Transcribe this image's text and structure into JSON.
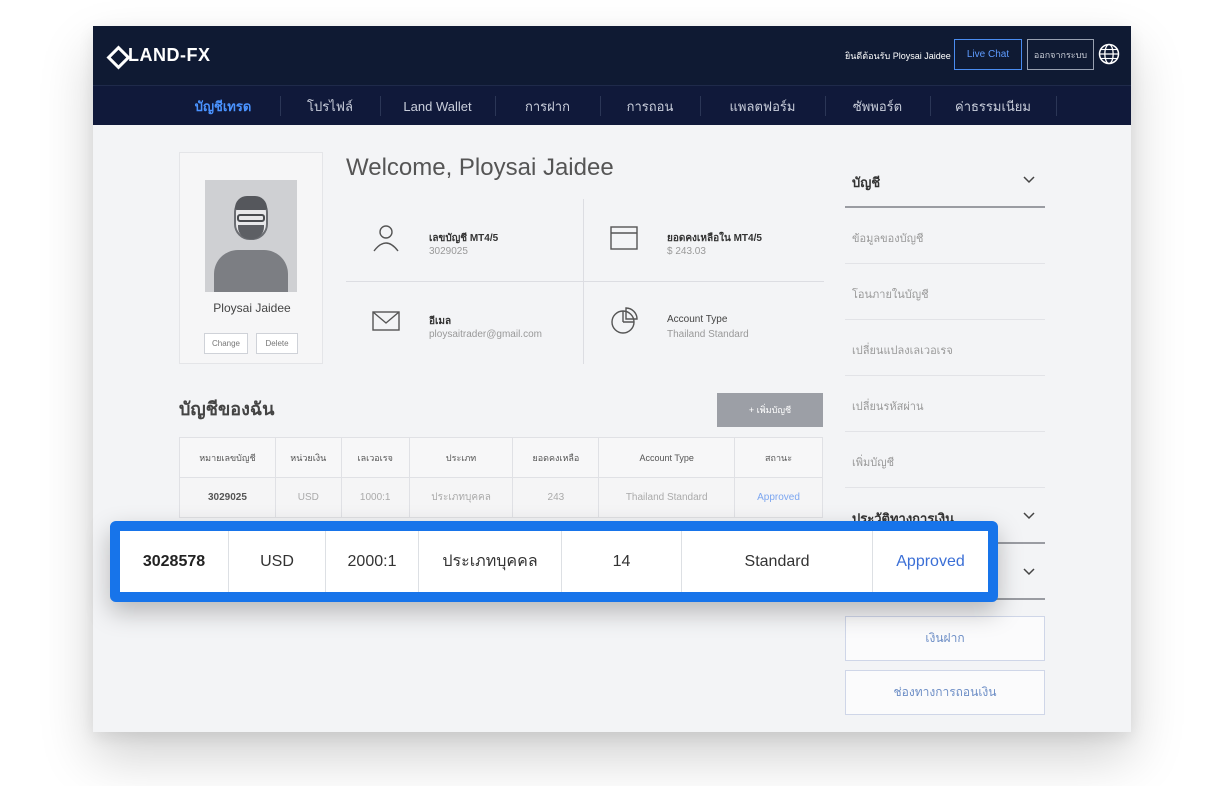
{
  "header": {
    "logo_text": "LAND-FX",
    "welcome": "ยินดีต้อนรับ Ploysai Jaidee",
    "live_chat": "Live Chat",
    "logout": "ออกจากระบบ"
  },
  "nav": {
    "items": [
      {
        "label": "บัญชีเทรด",
        "active": true
      },
      {
        "label": "โปรไฟล์"
      },
      {
        "label": "Land Wallet"
      },
      {
        "label": "การฝาก"
      },
      {
        "label": "การถอน"
      },
      {
        "label": "แพลตฟอร์ม"
      },
      {
        "label": "ซัพพอร์ต"
      },
      {
        "label": "ค่าธรรมเนียม"
      }
    ]
  },
  "profile": {
    "name": "Ploysai Jaidee",
    "change_label": "Change",
    "delete_label": "Delete"
  },
  "welcome_heading": "Welcome, Ploysai Jaidee",
  "info": {
    "account_label": "เลขบัญชี MT4/5",
    "account_value": "3029025",
    "balance_label": "ยอดคงเหลือใน MT4/5",
    "balance_value": "$ 243.03",
    "email_label": "อีเมล",
    "email_value": "ploysaitrader@gmail.com",
    "type_label": "Account Type",
    "type_value": "Thailand Standard"
  },
  "accounts": {
    "title": "บัญชีของฉัน",
    "add_button": "+ เพิ่มบัญชี",
    "headers": [
      "หมายเลขบัญชี",
      "หน่วยเงิน",
      "เลเวอเรจ",
      "ประเภท",
      "ยอดคงเหลือ",
      "Account Type",
      "สถานะ"
    ],
    "rows": [
      [
        "3029025",
        "USD",
        "1000:1",
        "ประเภทบุคคล",
        "243",
        "Thailand Standard",
        "Approved"
      ]
    ]
  },
  "sidebar": {
    "account_header": "บัญชี",
    "items": [
      "ข้อมูลของบัญชี",
      "โอนภายในบัญชี",
      "เปลี่ยนแปลงเลเวอเรจ",
      "เปลี่ยนรหัสผ่าน",
      "เพิ่มบัญชี"
    ],
    "history_header": "ประวัติทางการเงิน",
    "deposit_button": "เงินฝาก",
    "withdraw_button": "ช่องทางการถอนเงิน"
  },
  "highlight_row": {
    "account": "3028578",
    "currency": "USD",
    "leverage": "2000:1",
    "type": "ประเภทบุคคล",
    "balance": "14",
    "account_type": "Standard",
    "status": "Approved"
  },
  "colors": {
    "header_bg": "#0f1a33",
    "nav_active": "#4a93ff",
    "highlight_border": "#1774ea",
    "status_link": "#3b6fd6"
  }
}
